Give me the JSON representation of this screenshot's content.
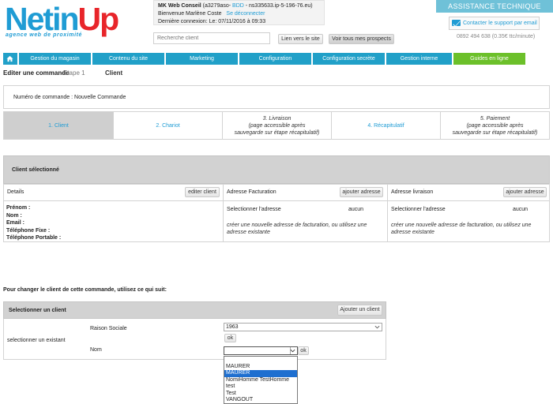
{
  "logo": {
    "part1": "Netin",
    "part2": "Up",
    "tagline": "agence web de proximité"
  },
  "user": {
    "company": "MK Web Conseil",
    "account": " (a3279aso- ",
    "bdd_link": "BDD",
    "server": " - ns335633.ip-5-196-76.eu)",
    "welcome": "Bienvenue Marlène Coste",
    "logout": "Se déconnecter",
    "last_login": "Dernière connexion: Le: 07/11/2016 à 09:33"
  },
  "header": {
    "search_placeholder": "Recherche client",
    "site_button": "Lien vers le site",
    "prospects_button": "Voir tous mes prospects",
    "assistance": "ASSISTANCE TECHNIQUE",
    "support_email": "Contacter le support par email",
    "phone": "0892 494 638 (0.35€ ttc/minute)"
  },
  "nav": [
    {
      "label": "Gestion du magasin"
    },
    {
      "label": "Contenu du site"
    },
    {
      "label": "Marketing"
    },
    {
      "label": "Configuration"
    },
    {
      "label": "Configuration secrète"
    },
    {
      "label": "Gestion interne"
    },
    {
      "label": "Guides en ligne"
    }
  ],
  "page": {
    "title": "Editer une commande",
    "step_label": "Etape 1",
    "step_name": "Client",
    "order_number": "Numéro de commande : Nouvelle Commande"
  },
  "steps": [
    {
      "line1": "1. Client",
      "line2": "",
      "line3": ""
    },
    {
      "line1": "2. Chariot",
      "line2": "",
      "line3": ""
    },
    {
      "line1": "3. Livraison",
      "line2": "(page accessible après",
      "line3": "sauvegarde sur étape récapitulatif)"
    },
    {
      "line1": "4. Récapitulatif",
      "line2": "",
      "line3": ""
    },
    {
      "line1": "5. Paiement",
      "line2": "(page accessible après",
      "line3": "sauvegarde sur étape récapitulatif)"
    }
  ],
  "client": {
    "section_title": "Client sélectionné",
    "details_label": "Details",
    "edit_button": "editer client",
    "billing_label": "Adresse Facturation",
    "billing_add": "ajouter adresse",
    "shipping_label": "Adresse livraison",
    "shipping_add": "ajouter adresse",
    "fields": [
      "Prénom :",
      "Nom :",
      "Email :",
      "Téléphone Fixe :",
      "Téléphone Portable :"
    ],
    "select_address": "Selectionner l'adresse",
    "none": "aucun",
    "create_hint": "créer une nouvelle adresse de facturation, ou utilisez une adresse existante"
  },
  "change": {
    "note": "Pour changer le client de cette commande, utilisez ce qui suit:",
    "panel_title": "Selectionner un client",
    "add_button": "Ajouter un client",
    "existing_label": "selectionner un existant",
    "raison_label": "Raison Sociale",
    "raison_value": "1963",
    "ok": "ok",
    "nom_label": "Nom",
    "nom_value": "",
    "options": [
      "",
      "MAURER",
      "MAURER",
      "NomiHomme TestHomme",
      "test",
      "Test",
      "VANGOUT"
    ]
  },
  "colors": {
    "nav": "#21a0c8",
    "guides": "#6cc02a",
    "logo_blue": "#1f9cd4",
    "logo_red": "#e8252a"
  }
}
